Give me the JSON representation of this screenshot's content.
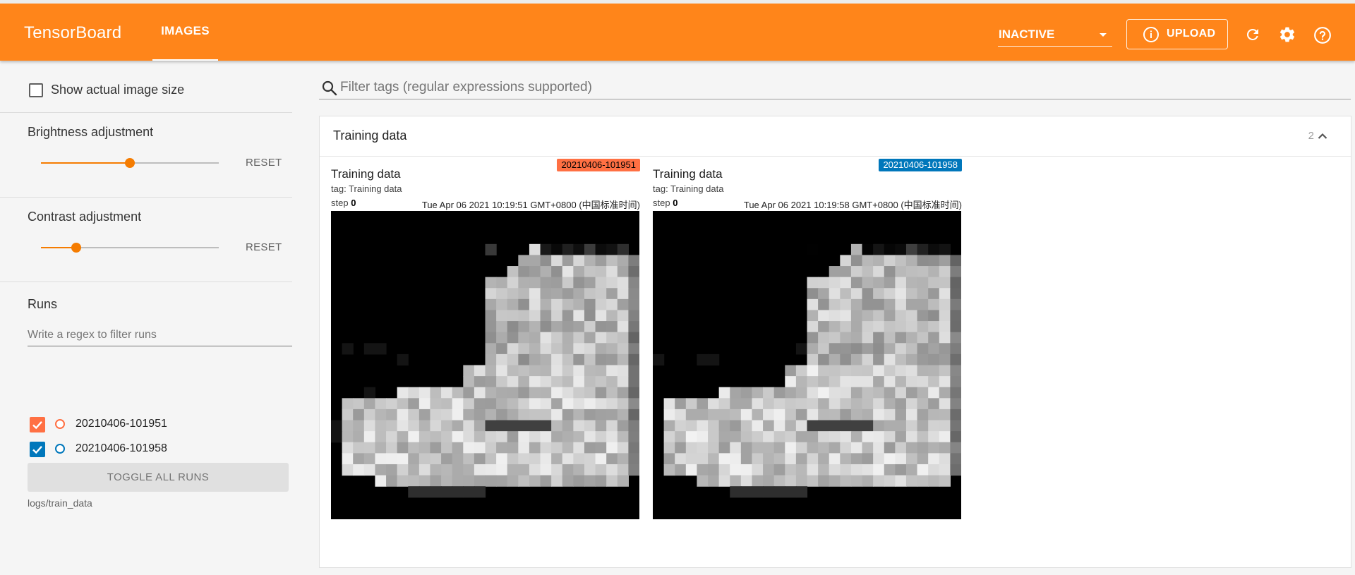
{
  "app": {
    "brand": "TensorBoard",
    "active_tab": "IMAGES"
  },
  "toolbar": {
    "reload_status": "INACTIVE",
    "upload_label": "UPLOAD",
    "icons": [
      "info-icon",
      "refresh-icon",
      "settings-icon",
      "help-icon"
    ]
  },
  "sidebar": {
    "show_actual_size_label": "Show actual image size",
    "show_actual_size_checked": false,
    "brightness": {
      "label": "Brightness adjustment",
      "reset": "RESET",
      "level": 0.5
    },
    "contrast": {
      "label": "Contrast adjustment",
      "reset": "RESET",
      "level": 0.2
    },
    "runs": {
      "heading": "Runs",
      "filter_placeholder": "Write a regex to filter runs",
      "items": [
        {
          "name": "20210406-101951",
          "checked": true,
          "color": "#ff7043"
        },
        {
          "name": "20210406-101958",
          "checked": true,
          "color": "#0077bb"
        }
      ],
      "toggle_all": "TOGGLE ALL RUNS",
      "logdir": "logs/train_data"
    }
  },
  "main": {
    "tag_filter_placeholder": "Filter tags (regular expressions supported)",
    "group": {
      "title": "Training data",
      "count": "2",
      "images": [
        {
          "title": "Training data",
          "tag": "tag: Training data",
          "step_label": "step",
          "step": "0",
          "time": "Tue Apr 06 2021 10:19:51 GMT+0800 (中国标准时间)",
          "run": "20210406-101951",
          "run_color": "#ff7043",
          "run_text_color": "#000000"
        },
        {
          "title": "Training data",
          "tag": "tag: Training data",
          "step_label": "step",
          "step": "0",
          "time": "Tue Apr 06 2021 10:19:58 GMT+0800 (中国标准时间)",
          "run": "20210406-101958",
          "run_color": "#0077bb",
          "run_text_color": "#ffffff"
        }
      ]
    }
  },
  "colors": {
    "accent": "#ff851a",
    "slider": "#f57c00"
  }
}
